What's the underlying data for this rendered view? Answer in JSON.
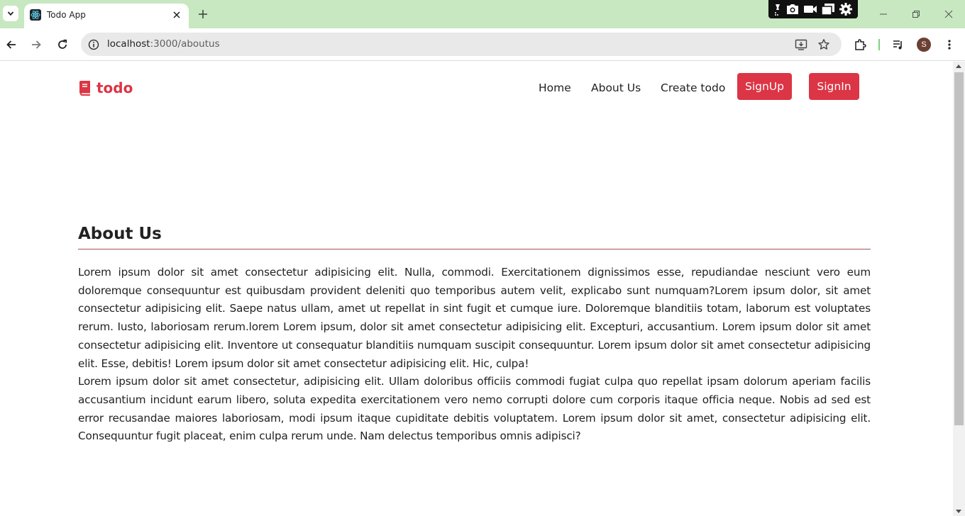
{
  "browser": {
    "tab": {
      "title": "Todo App"
    },
    "address": {
      "host": "localhost",
      "path": ":3000/aboutus"
    },
    "profile_initial": "S"
  },
  "navbar": {
    "brand": "todo",
    "links": [
      "Home",
      "About Us",
      "Create todo"
    ],
    "signup_label": "SignUp",
    "signin_label": "SignIn"
  },
  "about": {
    "heading": "About Us",
    "paragraph_1": "Lorem ipsum dolor sit amet consectetur adipisicing elit. Nulla, commodi. Exercitationem dignissimos esse, repudiandae nesciunt vero eum doloremque consequuntur est quibusdam provident deleniti quo temporibus autem velit, explicabo sunt numquam?Lorem ipsum dolor, sit amet consectetur adipisicing elit. Saepe natus ullam, amet ut repellat in sint fugit et cumque iure. Doloremque blanditiis totam, laborum est voluptates rerum. Iusto, laboriosam rerum.lorem Lorem ipsum, dolor sit amet consectetur adipisicing elit. Excepturi, accusantium. Lorem ipsum dolor sit amet consectetur adipisicing elit. Inventore ut consequatur blanditiis numquam suscipit consequuntur. Lorem ipsum dolor sit amet consectetur adipisicing elit. Esse, debitis! Lorem ipsum dolor sit amet consectetur adipisicing elit. Hic, culpa!",
    "paragraph_2": "Lorem ipsum dolor sit amet consectetur, adipisicing elit. Ullam doloribus officiis commodi fugiat culpa quo repellat ipsam dolorum aperiam facilis accusantium incidunt earum libero, soluta expedita exercitationem vero nemo corrupti dolore cum corporis itaque officia neque. Nobis ad sed est error recusandae maiores laboriosam, modi ipsum itaque cupiditate debitis voluptatem. Lorem ipsum dolor sit amet, consectetur adipisicing elit. Consequuntur fugit placeat, enim culpa rerum unde. Nam delectus temporibus omnis adipisci?"
  },
  "colors": {
    "brand": "#dc3545",
    "tabstrip": "#c7e8c0",
    "divider": "#a0525a"
  },
  "icons": {
    "brand": "book-icon",
    "tab_favicon": "react-icon"
  }
}
